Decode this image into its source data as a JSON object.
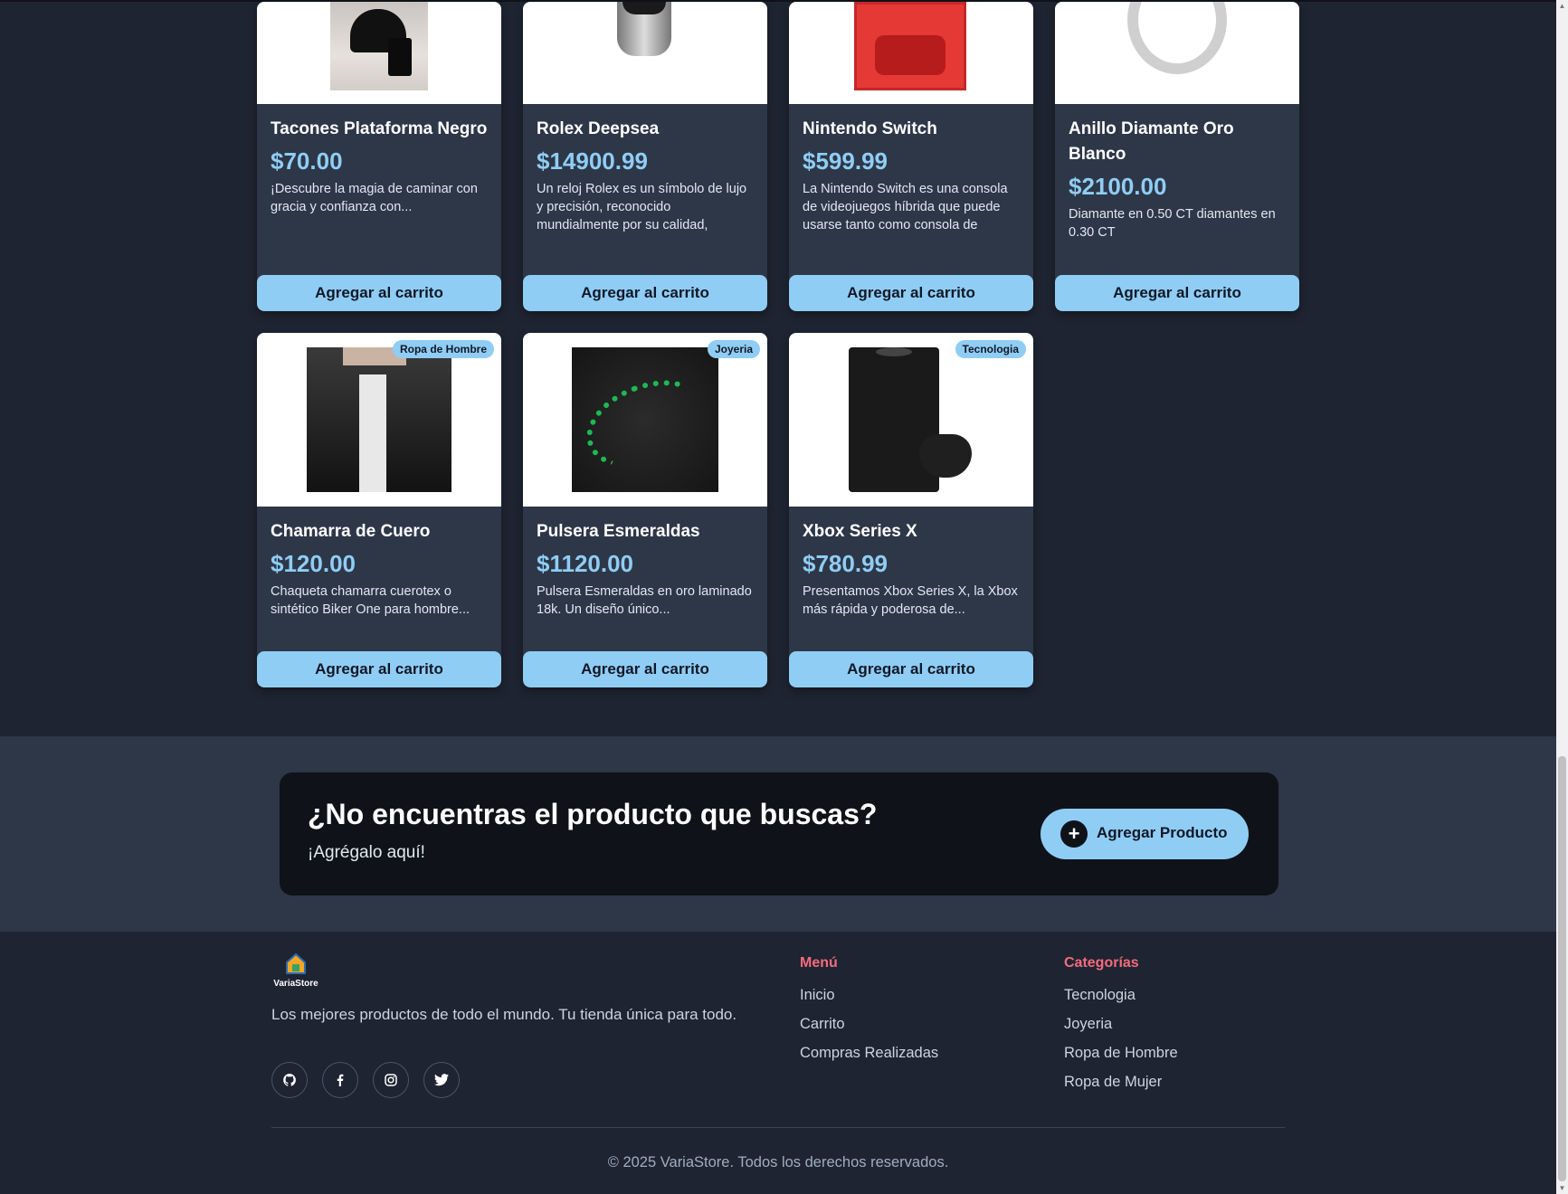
{
  "products_row1": [
    {
      "title": "Tacones Plataforma Negro",
      "price": "$70.00",
      "description": "¡Descubre la magia de caminar con gracia y confianza con...",
      "button": "Agregar al carrito",
      "image": "black-platform-heels-photo"
    },
    {
      "title": "Rolex Deepsea",
      "price": "$14900.99",
      "description": "Un reloj Rolex es un símbolo de lujo y precisión, reconocido mundialmente por su calidad, durabilidad y diseño elegante",
      "button": "Agregar al carrito",
      "image": "rolex-watch-photo"
    },
    {
      "title": "Nintendo Switch",
      "price": "$599.99",
      "description": "La Nintendo Switch es una consola de videojuegos híbrida que puede usarse tanto como consola de sobremesa",
      "button": "Agregar al carrito",
      "image": "nintendo-switch-box-photo"
    },
    {
      "title": "Anillo Diamante Oro Blanco",
      "price": "$2100.00",
      "description": "Diamante en 0.50 CT diamantes en 0.30 CT",
      "button": "Agregar al carrito",
      "image": "diamond-ring-photo"
    }
  ],
  "products_row2": [
    {
      "title": "Chamarra de Cuero",
      "price": "$120.00",
      "description": "Chaqueta chamarra cuerotex o sintético Biker One para hombre...",
      "button": "Agregar al carrito",
      "badge": "Ropa de Hombre",
      "image": "leather-jacket-photo"
    },
    {
      "title": "Pulsera Esmeraldas",
      "price": "$1120.00",
      "description": "Pulsera Esmeraldas en oro laminado 18k. Un diseño único...",
      "button": "Agregar al carrito",
      "badge": "Joyeria",
      "image": "emerald-bracelet-photo"
    },
    {
      "title": "Xbox Series X",
      "price": "$780.99",
      "description": "Presentamos Xbox Series X, la Xbox más rápida y poderosa de...",
      "button": "Agregar al carrito",
      "badge": "Tecnologia",
      "image": "xbox-series-x-photo"
    }
  ],
  "cta": {
    "heading": "¿No encuentras el producto que buscas?",
    "subheading": "¡Agrégalo aquí!",
    "button_label": "Agregar Producto",
    "button_icon": "plus-icon"
  },
  "footer": {
    "brand": "VariaStore",
    "tagline": "Los mejores productos de todo el mundo. Tu tienda única para todo.",
    "social_icons": [
      "github-icon",
      "facebook-icon",
      "instagram-icon",
      "twitter-icon"
    ],
    "menu_title": "Menú",
    "menu_links": [
      "Inicio",
      "Carrito",
      "Compras Realizadas"
    ],
    "categories_title": "Categorías",
    "category_links": [
      "Tecnologia",
      "Joyeria",
      "Ropa de Hombre",
      "Ropa de Mujer"
    ],
    "copyright": "© 2025 VariaStore. Todos los derechos reservados."
  },
  "colors": {
    "page_bg": "#1e2431",
    "card_bg": "#2d3748",
    "accent": "#90cdf4",
    "footer_heading": "#f56b7e",
    "banner_bg": "#0f1319"
  }
}
